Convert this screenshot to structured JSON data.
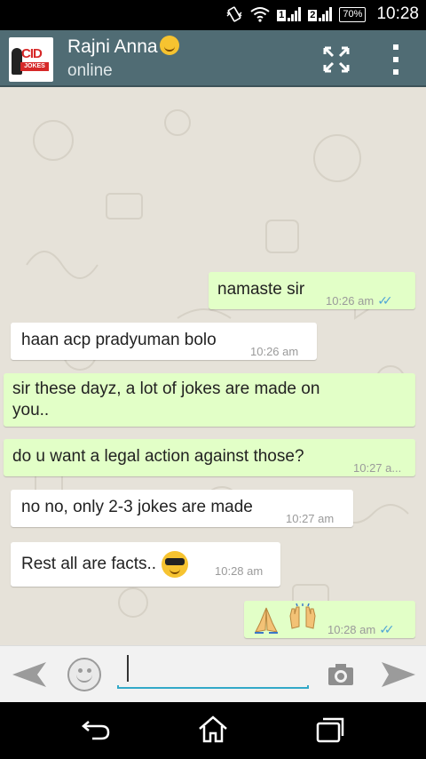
{
  "status_bar": {
    "sim1": "1",
    "sim2": "2",
    "roaming": "R",
    "battery": "70%",
    "time": "10:28"
  },
  "header": {
    "avatar_logo": "CID",
    "avatar_subtitle": "JOKES",
    "contact_name": "Rajni Anna",
    "contact_status": "online",
    "icons": [
      "back-icon",
      "expand-icon",
      "overflow-menu-icon"
    ]
  },
  "messages": [
    {
      "direction": "out",
      "text": "namaste sir",
      "time": "10:26 am",
      "read": true
    },
    {
      "direction": "in",
      "text": "haan acp pradyuman bolo",
      "time": "10:26 am"
    },
    {
      "direction": "out",
      "text_line1": "sir these dayz, a lot of jokes are made on",
      "text_line2": "you..",
      "time": ""
    },
    {
      "direction": "out",
      "text": "do u want a legal action against those?",
      "time": "10:27 a..."
    },
    {
      "direction": "in",
      "text": "no no, only 2-3 jokes are made",
      "time": "10:27 am"
    },
    {
      "direction": "in",
      "text": "Rest all are facts..",
      "emoji": "cool-sunglasses-emoji",
      "time": "10:28 am"
    },
    {
      "direction": "out",
      "emojis": [
        "folded-hands-emoji",
        "raised-hands-emoji"
      ],
      "time": "10:28 am",
      "read": true
    }
  ],
  "input_bar": {
    "placeholder": "",
    "value": ""
  },
  "colors": {
    "header_bg": "#506c74",
    "chat_bg": "#e6e2d9",
    "outgoing_bubble": "#e2ffc7",
    "incoming_bubble": "#ffffff",
    "read_ticks": "#4fa6d6",
    "input_underline": "#33a9c8"
  }
}
